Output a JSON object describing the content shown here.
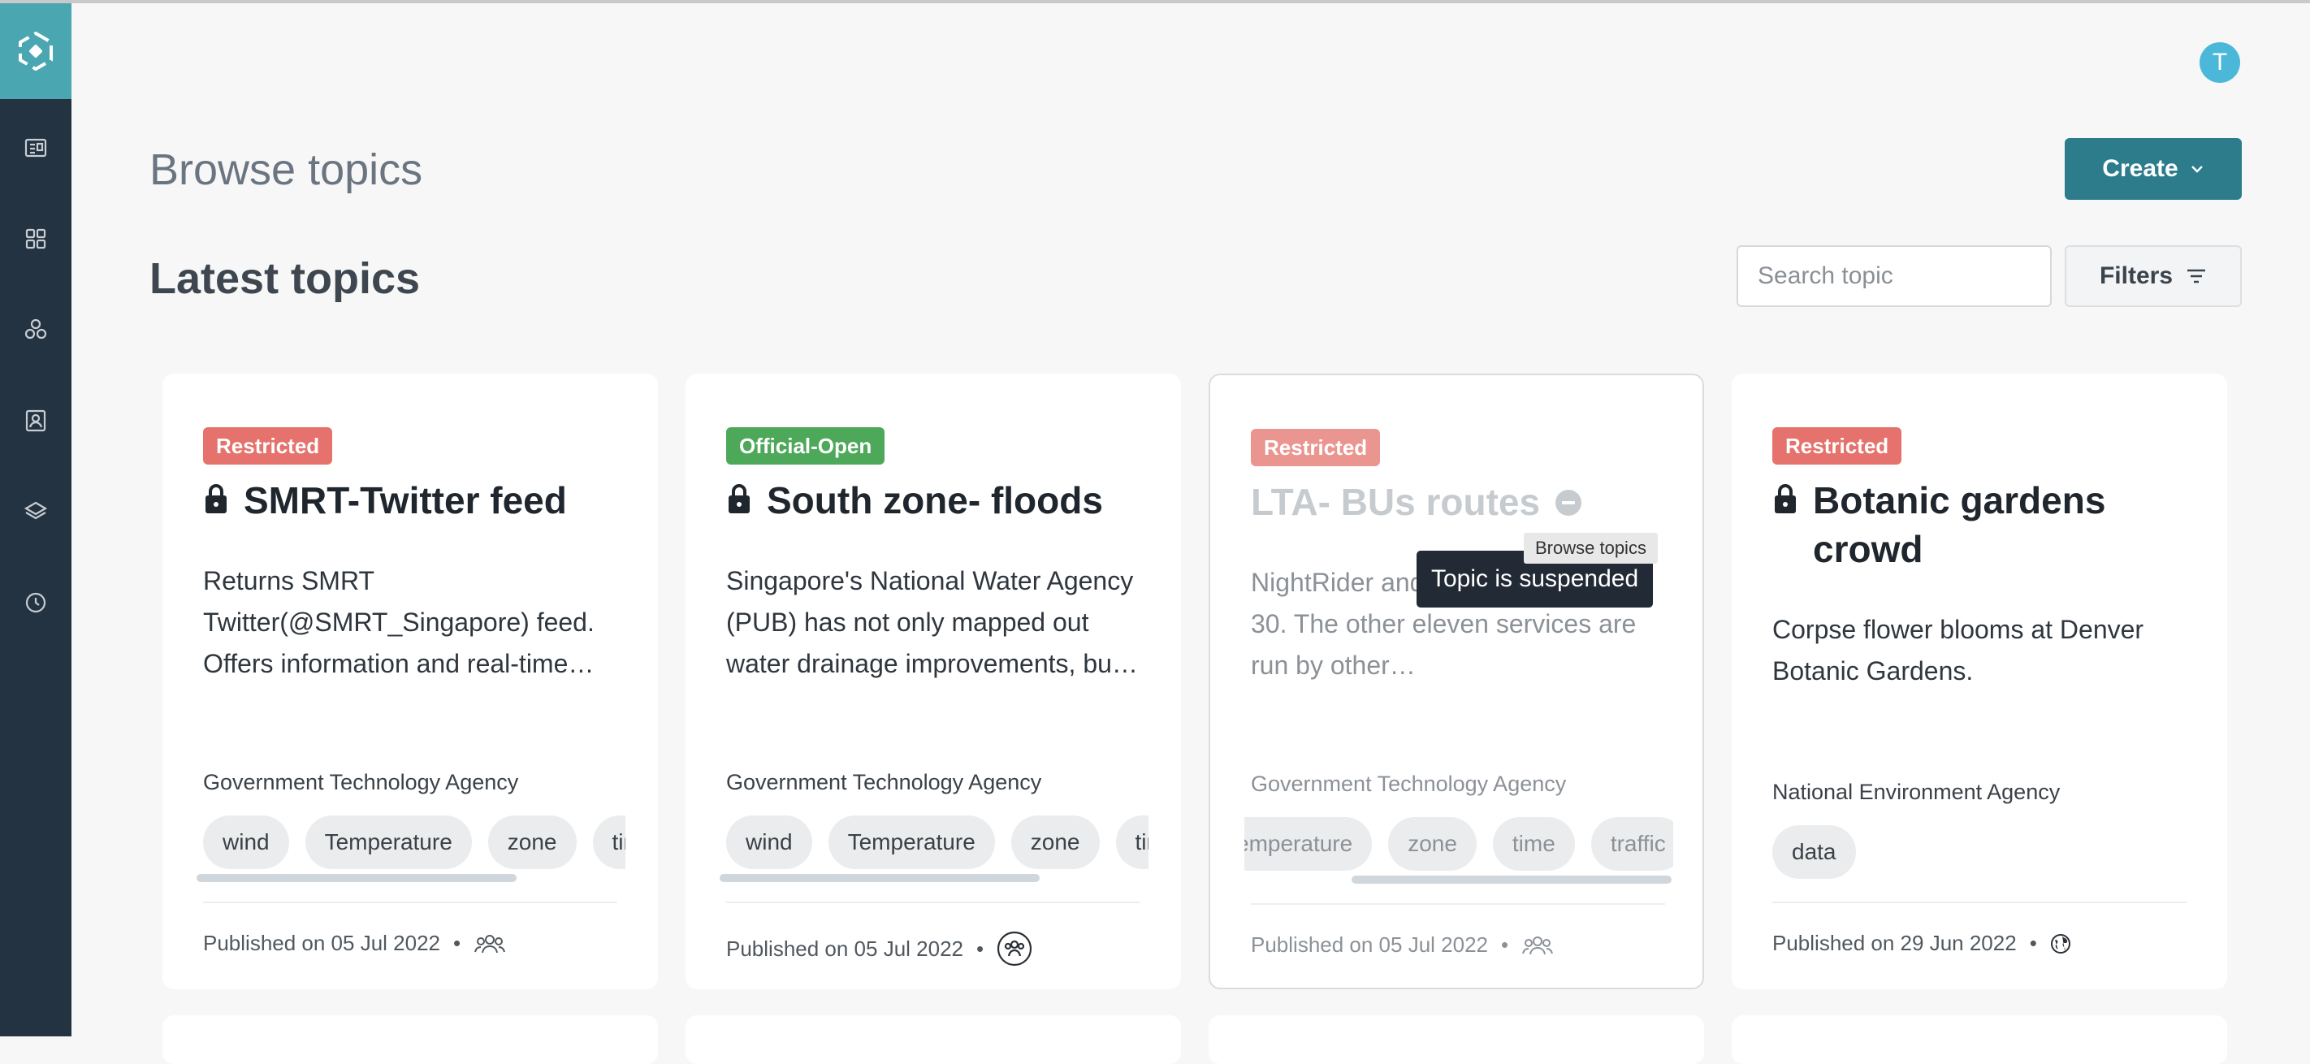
{
  "header": {
    "page_title": "Browse topics",
    "section_title": "Latest topics",
    "create_label": "Create",
    "filters_label": "Filters",
    "search_placeholder": "Search topic",
    "avatar_initial": "T"
  },
  "sidebar": {
    "items": [
      {
        "icon": "catalog-icon"
      },
      {
        "icon": "grid-icon"
      },
      {
        "icon": "molecule-icon"
      },
      {
        "icon": "contacts-icon"
      },
      {
        "icon": "layers-icon"
      },
      {
        "icon": "clock-icon"
      }
    ]
  },
  "tooltips": {
    "browse": "Browse topics",
    "suspended": "Topic is suspended"
  },
  "cards": [
    {
      "badge": "Restricted",
      "title": "SMRT-Twitter feed",
      "description": "Returns SMRT Twitter(@SMRT_Singapore) feed. Offers information and real-time…",
      "agency": "Government Technology Agency",
      "tags": [
        "wind",
        "Temperature",
        "zone",
        "tim"
      ],
      "published": "Published on 05 Jul 2022",
      "visibility_icon": "group-icon"
    },
    {
      "badge": "Official-Open",
      "title": "South zone- floods",
      "description": "Singapore's National Water Agency (PUB) has not only mapped out water drainage improvements, bu…",
      "agency": "Government Technology Agency",
      "tags": [
        "wind",
        "Temperature",
        "zone",
        "tim"
      ],
      "published": "Published on 05 Jul 2022",
      "visibility_icon": "group-circle-icon"
    },
    {
      "badge": "Restricted",
      "title": "LTA- BUs routes",
      "description": "NightRider and s to stop from June 30. The other eleven services are run by other…",
      "agency": "Government Technology Agency",
      "tags": [
        "emperature",
        "zone",
        "time",
        "traffic"
      ],
      "published": "Published on 05 Jul 2022",
      "visibility_icon": "group-icon"
    },
    {
      "badge": "Restricted",
      "title": "Botanic gardens crowd",
      "description": "Corpse flower blooms at Denver Botanic Gardens.",
      "agency": "National Environment Agency",
      "tags": [
        "data"
      ],
      "published": "Published on 29 Jun 2022",
      "visibility_icon": "globe-icon"
    }
  ],
  "colors": {
    "sidebar": "#243341",
    "logo_bg": "#4aa7b1",
    "primary": "#2c7c8c",
    "restricted": "#e5726c",
    "official_open": "#4da85a"
  }
}
